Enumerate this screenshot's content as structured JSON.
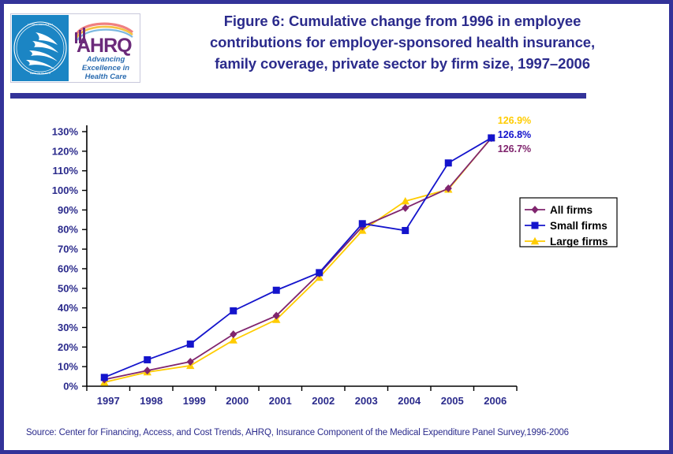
{
  "header": {
    "title_lines": [
      "Figure 6: Cumulative change from 1996 in employee",
      "contributions for employer-sponsored health insurance,",
      "family coverage, private sector by firm size, 1997–2006"
    ],
    "logo": {
      "agency_acronym": "AHRQ",
      "tagline_lines": [
        "Advancing",
        "Excellence in",
        "Health Care"
      ],
      "seal_text": "DEPARTMENT OF HEALTH & HUMAN SERVICES · USA"
    }
  },
  "source": {
    "text": "Source: Center for Financing, Access, and Cost Trends, AHRQ, Insurance Component of the Medical Expenditure Panel Survey,1996-2006"
  },
  "colors": {
    "border": "#333399",
    "rule": "#333399",
    "title_text": "#2b2b8c",
    "axis_text": "#2b2b8c",
    "axis_line": "#000000",
    "all_firms": "#80256e",
    "small_firms": "#1414cc",
    "large_firms": "#ffcc00",
    "legend_border": "#000000",
    "legend_text": "#000000"
  },
  "chart_data": {
    "type": "line",
    "title": "Figure 6: Cumulative change from 1996 in employee contributions for employer-sponsored health insurance, family coverage, private sector by firm size, 1997–2006",
    "xlabel": "",
    "ylabel": "",
    "x": [
      "1997",
      "1998",
      "1999",
      "2000",
      "2001",
      "2002",
      "2003",
      "2004",
      "2005",
      "2006"
    ],
    "categories": [
      "1997",
      "1998",
      "1999",
      "2000",
      "2001",
      "2002",
      "2003",
      "2004",
      "2005",
      "2006"
    ],
    "ylim": [
      0,
      130
    ],
    "ytick_values": [
      0,
      10,
      20,
      30,
      40,
      50,
      60,
      70,
      80,
      90,
      100,
      110,
      120,
      130
    ],
    "ytick_labels": [
      "0%",
      "10%",
      "20%",
      "30%",
      "40%",
      "50%",
      "60%",
      "70%",
      "80%",
      "90%",
      "100%",
      "110%",
      "120%",
      "130%"
    ],
    "grid": false,
    "legend_position": "right",
    "series": [
      {
        "name": "All firms",
        "color": "#80256e",
        "marker": "diamond",
        "values": [
          3.4,
          8.0,
          12.5,
          26.5,
          36.0,
          57.5,
          81.5,
          91.0,
          101.0,
          126.7
        ],
        "end_label": "126.7%"
      },
      {
        "name": "Small firms",
        "color": "#1414cc",
        "marker": "square",
        "values": [
          4.5,
          13.5,
          21.5,
          38.5,
          49.0,
          58.0,
          83.0,
          79.5,
          114.0,
          126.8
        ],
        "end_label": "126.8%"
      },
      {
        "name": "Large firms",
        "color": "#ffcc00",
        "marker": "triangle",
        "values": [
          2.0,
          7.2,
          10.5,
          23.5,
          34.0,
          55.5,
          79.5,
          94.5,
          100.5,
          126.9
        ],
        "end_label": "126.9%"
      }
    ],
    "annotations": [
      {
        "text": "126.9%",
        "color": "#ffcc00",
        "series": "Large firms"
      },
      {
        "text": "126.8%",
        "color": "#1414cc",
        "series": "Small firms"
      },
      {
        "text": "126.7%",
        "color": "#80256e",
        "series": "All firms"
      }
    ]
  }
}
